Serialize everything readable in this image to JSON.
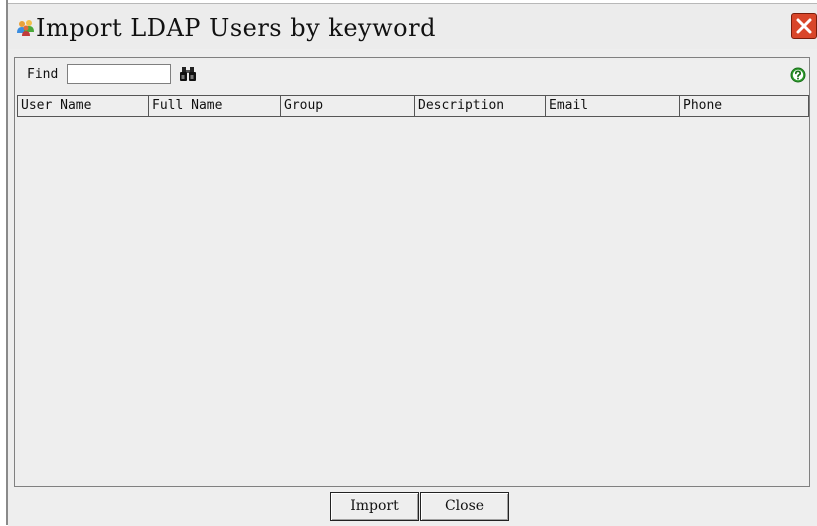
{
  "dialog": {
    "title": "Import LDAP Users by keyword",
    "title_icon": "users-icon",
    "close_icon": "close-icon",
    "close_color": "#d9462a"
  },
  "search": {
    "label": "Find",
    "value": "",
    "placeholder": "",
    "search_icon": "binoculars-icon",
    "help_icon": "help-icon",
    "help_color": "#2e9c2e"
  },
  "table": {
    "columns": [
      "User Name",
      "Full Name",
      "Group",
      "Description",
      "Email",
      "Phone"
    ],
    "rows": []
  },
  "buttons": {
    "import_label": "Import",
    "close_label": "Close"
  }
}
